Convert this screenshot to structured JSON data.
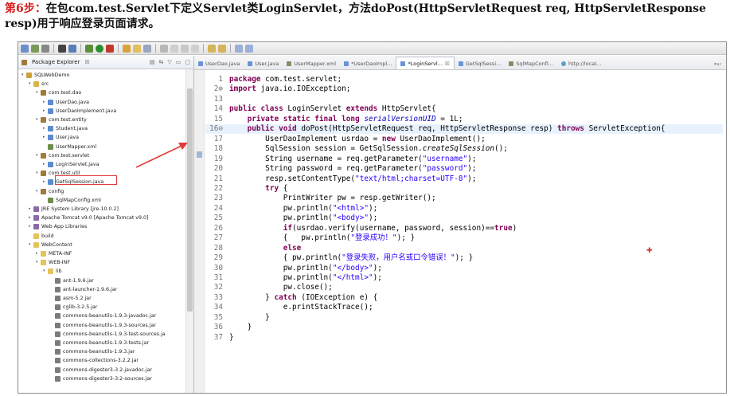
{
  "heading": {
    "step": "第6步：",
    "text": "在包com.test.Servlet下定义Servlet类LoginServlet，方法doPost(HttpServletRequest req, HttpServletResponse resp)用于响应登录页面请求。"
  },
  "package_explorer": {
    "title": "Package Explorer",
    "close": "☒",
    "tree": [
      {
        "label": "SQLWebDemo",
        "indent": 0,
        "icon": "project-icon",
        "twisty": "▾"
      },
      {
        "label": "src",
        "indent": 1,
        "icon": "source-folder-icon",
        "twisty": "▾"
      },
      {
        "label": "com.test.dao",
        "indent": 2,
        "icon": "package-icon",
        "twisty": "▾"
      },
      {
        "label": "UserDao.java",
        "indent": 3,
        "icon": "java-file-icon",
        "twisty": "▸"
      },
      {
        "label": "UserDaoImplement.java",
        "indent": 3,
        "icon": "java-file-icon",
        "twisty": "▸"
      },
      {
        "label": "com.test.entity",
        "indent": 2,
        "icon": "package-icon",
        "twisty": "▾"
      },
      {
        "label": "Student.java",
        "indent": 3,
        "icon": "java-file-icon",
        "twisty": "▸"
      },
      {
        "label": "User.java",
        "indent": 3,
        "icon": "java-file-icon",
        "twisty": "▸"
      },
      {
        "label": "UserMapper.xml",
        "indent": 3,
        "icon": "xml-file-icon",
        "twisty": ""
      },
      {
        "label": "com.test.servlet",
        "indent": 2,
        "icon": "package-icon",
        "twisty": "▾"
      },
      {
        "label": "LoginServlet.java",
        "indent": 3,
        "icon": "java-file-icon",
        "twisty": "▸"
      },
      {
        "label": "com.test.util",
        "indent": 2,
        "icon": "package-icon",
        "twisty": "▾"
      },
      {
        "label": "GetSqlSession.java",
        "indent": 3,
        "icon": "java-file-icon",
        "twisty": "▸"
      },
      {
        "label": "config",
        "indent": 2,
        "icon": "package-icon",
        "twisty": "▾"
      },
      {
        "label": "SqlMapConfig.xml",
        "indent": 3,
        "icon": "xml-file-icon",
        "twisty": ""
      },
      {
        "label": "JRE System Library [jre-10.0.2]",
        "indent": 1,
        "icon": "library-icon",
        "twisty": "▸"
      },
      {
        "label": "Apache Tomcat v9.0 [Apache Tomcat v9.0]",
        "indent": 1,
        "icon": "library-icon",
        "twisty": "▸"
      },
      {
        "label": "Web App Libraries",
        "indent": 1,
        "icon": "library-icon",
        "twisty": "▸"
      },
      {
        "label": "build",
        "indent": 1,
        "icon": "folder-icon",
        "twisty": ""
      },
      {
        "label": "WebContent",
        "indent": 1,
        "icon": "folder-icon",
        "twisty": "▾"
      },
      {
        "label": "META-INF",
        "indent": 2,
        "icon": "folder-icon",
        "twisty": "▸"
      },
      {
        "label": "WEB-INF",
        "indent": 2,
        "icon": "folder-icon",
        "twisty": "▾"
      },
      {
        "label": "lib",
        "indent": 3,
        "icon": "folder-icon",
        "twisty": "▾"
      },
      {
        "label": "ant-1.9.6.jar",
        "indent": 4,
        "icon": "jar-icon",
        "twisty": ""
      },
      {
        "label": "ant-launcher-1.9.6.jar",
        "indent": 4,
        "icon": "jar-icon",
        "twisty": ""
      },
      {
        "label": "asm-5.2.jar",
        "indent": 4,
        "icon": "jar-icon",
        "twisty": ""
      },
      {
        "label": "cglib-3.2.5.jar",
        "indent": 4,
        "icon": "jar-icon",
        "twisty": ""
      },
      {
        "label": "commons-beanutils-1.9.3-javadoc.jar",
        "indent": 4,
        "icon": "jar-icon",
        "twisty": ""
      },
      {
        "label": "commons-beanutils-1.9.3-sources.jar",
        "indent": 4,
        "icon": "jar-icon",
        "twisty": ""
      },
      {
        "label": "commons-beanutils-1.9.3-test-sources.ja",
        "indent": 4,
        "icon": "jar-icon",
        "twisty": ""
      },
      {
        "label": "commons-beanutils-1.9.3-tests.jar",
        "indent": 4,
        "icon": "jar-icon",
        "twisty": ""
      },
      {
        "label": "commons-beanutils-1.9.3.jar",
        "indent": 4,
        "icon": "jar-icon",
        "twisty": ""
      },
      {
        "label": "commons-collections-3.2.2.jar",
        "indent": 4,
        "icon": "jar-icon",
        "twisty": ""
      },
      {
        "label": "commons-digester3-3.2-javadoc.jar",
        "indent": 4,
        "icon": "jar-icon",
        "twisty": ""
      },
      {
        "label": "commons-digester3-3.2-sources.jar",
        "indent": 4,
        "icon": "jar-icon",
        "twisty": ""
      }
    ]
  },
  "editor": {
    "tabs": [
      {
        "label": "UserDao.java",
        "icon": "java",
        "active": false
      },
      {
        "label": "User.java",
        "icon": "java",
        "active": false
      },
      {
        "label": "UserMapper.xml",
        "icon": "xml",
        "active": false
      },
      {
        "label": "*UserDaoImpl...",
        "icon": "java",
        "active": false
      },
      {
        "label": "*LoginServl...",
        "icon": "java",
        "active": true
      },
      {
        "label": "GetSqlSessi...",
        "icon": "java",
        "active": false
      },
      {
        "label": "SqlMapConfi...",
        "icon": "xml",
        "active": false
      },
      {
        "label": "http://local...",
        "icon": "web",
        "active": false
      }
    ],
    "overflow": "»₂₇",
    "lines": [
      {
        "n": "1",
        "tokens": [
          [
            "kw",
            "package"
          ],
          [
            "t",
            " com.test.servlet;"
          ]
        ]
      },
      {
        "n": "2⊕",
        "tokens": [
          [
            "kw",
            "import"
          ],
          [
            "t",
            " java.io.IOException;"
          ]
        ]
      },
      {
        "n": "13",
        "tokens": [
          [
            "t",
            ""
          ]
        ]
      },
      {
        "n": "14",
        "tokens": [
          [
            "kw",
            "public class"
          ],
          [
            "t",
            " LoginServlet "
          ],
          [
            "kw",
            "extends"
          ],
          [
            "t",
            " HttpServlet{"
          ]
        ]
      },
      {
        "n": "15",
        "tokens": [
          [
            "t",
            "    "
          ],
          [
            "kw",
            "private static final long"
          ],
          [
            "t",
            " "
          ],
          [
            "fld",
            "serialVersionUID"
          ],
          [
            "t",
            " = 1L;"
          ]
        ]
      },
      {
        "n": "16⊖",
        "tokens": [
          [
            "t",
            "    "
          ],
          [
            "kw",
            "public void"
          ],
          [
            "t",
            " doPost(HttpServletRequest req, HttpServletResponse resp) "
          ],
          [
            "kw",
            "throws"
          ],
          [
            "t",
            " ServletException{"
          ]
        ]
      },
      {
        "n": "17",
        "tokens": [
          [
            "t",
            "        UserDaoImplement usrdao = "
          ],
          [
            "kw",
            "new"
          ],
          [
            "t",
            " UserDaoImplement();"
          ]
        ]
      },
      {
        "n": "18",
        "tokens": [
          [
            "t",
            "        SqlSession session = GetSqlSession."
          ],
          [
            "ital",
            "createSqlSession"
          ],
          [
            "t",
            "();"
          ]
        ]
      },
      {
        "n": "19",
        "tokens": [
          [
            "t",
            "        String username = req.getParameter("
          ],
          [
            "str",
            "\"username\""
          ],
          [
            "t",
            ");"
          ]
        ]
      },
      {
        "n": "20",
        "tokens": [
          [
            "t",
            "        String password = req.getParameter("
          ],
          [
            "str",
            "\"password\""
          ],
          [
            "t",
            ");"
          ]
        ]
      },
      {
        "n": "21",
        "tokens": [
          [
            "t",
            "        resp.setContentType("
          ],
          [
            "str",
            "\"text/html;charset=UTF-8\""
          ],
          [
            "t",
            ");"
          ]
        ]
      },
      {
        "n": "22",
        "tokens": [
          [
            "t",
            "        "
          ],
          [
            "kw",
            "try"
          ],
          [
            "t",
            " {"
          ]
        ]
      },
      {
        "n": "23",
        "tokens": [
          [
            "t",
            "            PrintWriter pw = resp.getWriter();"
          ]
        ]
      },
      {
        "n": "24",
        "tokens": [
          [
            "t",
            "            pw.println("
          ],
          [
            "str",
            "\"<html>\""
          ],
          [
            "t",
            ");"
          ]
        ]
      },
      {
        "n": "25",
        "tokens": [
          [
            "t",
            "            pw.println("
          ],
          [
            "str",
            "\"<body>\""
          ],
          [
            "t",
            ");"
          ]
        ]
      },
      {
        "n": "26",
        "tokens": [
          [
            "t",
            "            "
          ],
          [
            "kw",
            "if"
          ],
          [
            "t",
            "(usrdao.verify(username, password, session)=="
          ],
          [
            "kw",
            "true"
          ],
          [
            "t",
            ")"
          ]
        ]
      },
      {
        "n": "27",
        "tokens": [
          [
            "t",
            "            {   pw.println("
          ],
          [
            "str",
            "\"登录成功！\""
          ],
          [
            "t",
            "); }"
          ]
        ]
      },
      {
        "n": "28",
        "tokens": [
          [
            "t",
            "            "
          ],
          [
            "kw",
            "else"
          ]
        ]
      },
      {
        "n": "29",
        "tokens": [
          [
            "t",
            "            { pw.println("
          ],
          [
            "str",
            "\"登录失败，用户名或口令错误！\""
          ],
          [
            "t",
            "); }"
          ]
        ]
      },
      {
        "n": "30",
        "tokens": [
          [
            "t",
            "            pw.println("
          ],
          [
            "str",
            "\"</body>\""
          ],
          [
            "t",
            ");"
          ]
        ]
      },
      {
        "n": "31",
        "tokens": [
          [
            "t",
            "            pw.println("
          ],
          [
            "str",
            "\"</html>\""
          ],
          [
            "t",
            ");"
          ]
        ]
      },
      {
        "n": "32",
        "tokens": [
          [
            "t",
            "            pw.close();"
          ]
        ]
      },
      {
        "n": "33",
        "tokens": [
          [
            "t",
            "        } "
          ],
          [
            "kw",
            "catch"
          ],
          [
            "t",
            " (IOException e) {"
          ]
        ]
      },
      {
        "n": "34",
        "tokens": [
          [
            "t",
            "            e.printStackTrace();"
          ]
        ]
      },
      {
        "n": "35",
        "tokens": [
          [
            "t",
            "        }"
          ]
        ]
      },
      {
        "n": "36",
        "tokens": [
          [
            "t",
            "    }"
          ]
        ]
      },
      {
        "n": "37",
        "tokens": [
          [
            "t",
            "}"
          ]
        ]
      }
    ]
  },
  "colors": {
    "heading_step": "#d42020",
    "keyword": "#7f0055",
    "string": "#2a00ff",
    "field": "#0000c0",
    "annotation_red": "#e23b3b"
  }
}
